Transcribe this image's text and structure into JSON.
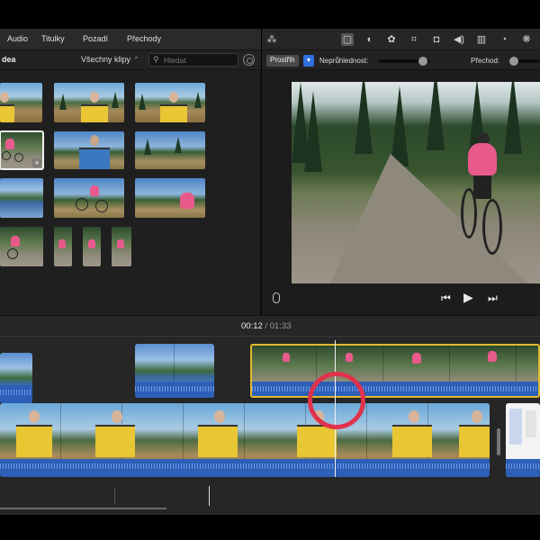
{
  "browser": {
    "tabs": [
      "Audio",
      "Titulky",
      "Pozadí",
      "Přechody"
    ],
    "media_title": "dea",
    "clips_filter": "Všechny klipy",
    "search_placeholder": "Hledat"
  },
  "viewer": {
    "style_label": "Prostřih",
    "opacity_label": "Neprůhlednost:",
    "transition_label": "Přechod:",
    "opacity_value": 0.95,
    "tools": [
      "crop-overlay-icon",
      "color-balance-icon",
      "color-palette-icon",
      "crop-icon",
      "stabilization-camera-icon",
      "volume-icon",
      "equalizer-icon",
      "speed-icon",
      "effects-icon"
    ]
  },
  "timeline": {
    "current_time": "00:12",
    "separator": "/",
    "total_time": "01:33"
  },
  "colors": {
    "selection": "#e3b92f",
    "audio_wave": "#2c5fb8",
    "focus_ring": "#e0324b",
    "accent_blue": "#2f6fe0"
  }
}
